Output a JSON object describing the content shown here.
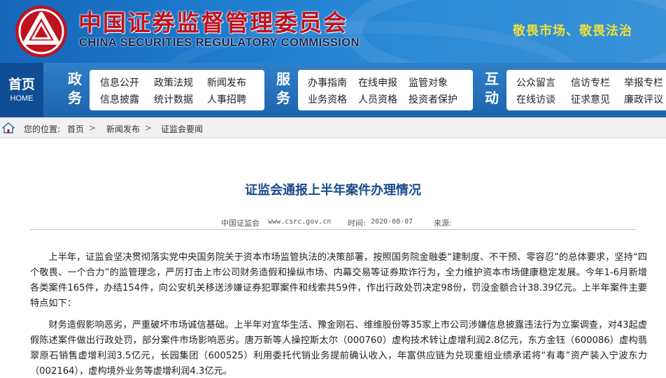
{
  "header": {
    "title_cn": "中国证券监督管理委员会",
    "title_en": "CHINA SECURITIES REGULATORY COMMISSION",
    "slogan": "敬畏市场、敬畏法治",
    "logo": "csrc-logo",
    "colors": {
      "brand_red": "#c1121f",
      "header_blue": "#1e7ccf",
      "slogan_yellow": "#f0e03a"
    }
  },
  "nav": {
    "home_cn": "首页",
    "home_en": "HOME",
    "sections": [
      {
        "label": "政务",
        "items": [
          "信息公开",
          "政策法规",
          "新闻发布",
          "信息披露",
          "统计数据",
          "人事招聘"
        ]
      },
      {
        "label": "服务",
        "items": [
          "办事指南",
          "在线申报",
          "监管对象",
          "业务资格",
          "人员资格",
          "投资者保护"
        ]
      },
      {
        "label": "互动",
        "items": [
          "公众留言",
          "信访专栏",
          "举报专栏",
          "在线访谈",
          "征求意见",
          "廉政评议"
        ]
      }
    ]
  },
  "breadcrumb": {
    "icon": "home-icon",
    "label": "您的位置:",
    "items": [
      "首页",
      "新闻发布",
      "证监会要闻"
    ],
    "separator": ">"
  },
  "article": {
    "title": "证监会通报上半年案件办理情况",
    "site": "中国证监会",
    "url": "www.csrc.gov.cn",
    "time_label": "时间:",
    "time": "2020-08-07",
    "source_label": "来源:",
    "paragraphs": [
      "上半年，证监会坚决贯彻落实党中央国务院关于资本市场监管执法的决策部署，按照国务院金融委“建制度、不干预、零容忍”的总体要求，坚持“四个敬畏、一个合力”的监管理念，严厉打击上市公司财务造假和操纵市场、内幕交易等证券欺诈行为，全力维护资本市场健康稳定发展。今年1-6月新增各类案件165件，办结154件，向公安机关移送涉嫌证券犯罪案件和线索共59件，作出行政处罚决定98份，罚没金额合计38.39亿元。上半年案件主要特点如下：",
      "财务造假影响恶劣，严重破坏市场诚信基础。上半年对宜华生活、豫金刚石、维维股份等35家上市公司涉嫌信息披露违法行为立案调查，对43起虚假陈述案件做出行政处罚，部分案件市场影响恶劣。唐万新等人操控斯太尔（000760）虚构技术转让虚增利润2.8亿元，东方金钰（600086）虚构翡翠原石销售虚增利润3.5亿元，长园集团（600525）利用委托代销业务提前确认收入，年富供应链为兑现重组业绩承诺将“有毒”资产装入宁波东力（002164），虚构境外业务等虚增利润4.3亿元。"
    ]
  }
}
